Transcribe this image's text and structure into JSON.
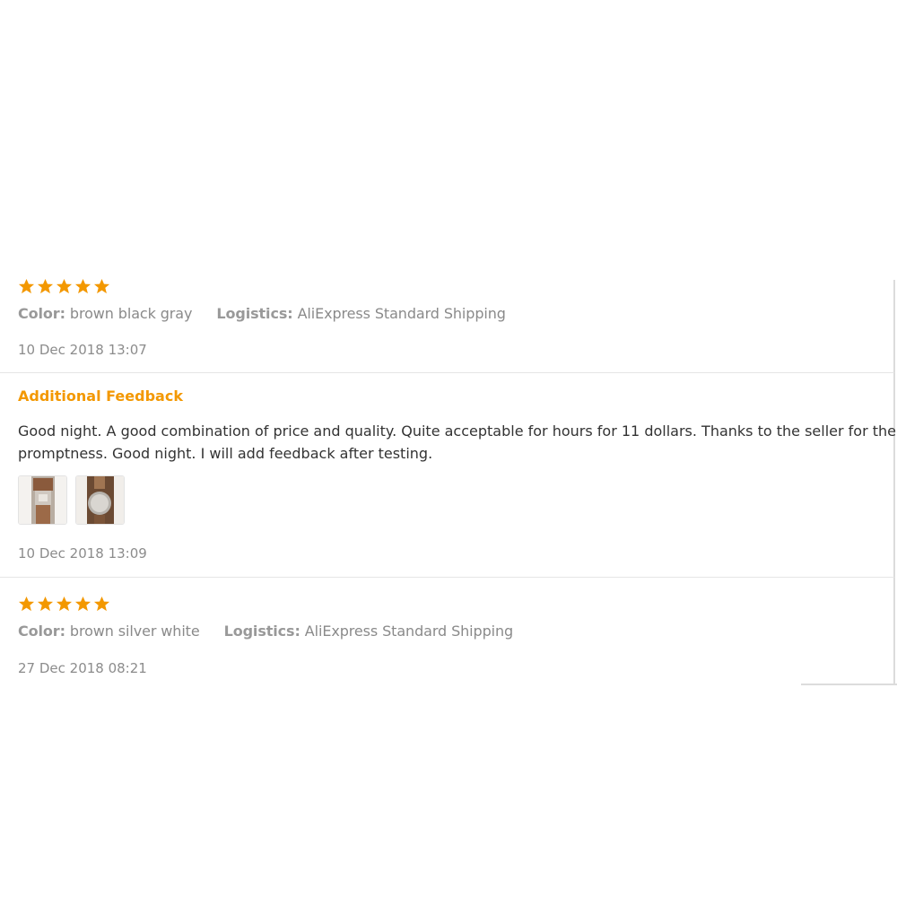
{
  "colors": {
    "star": "#f39800",
    "accent": "#f39800",
    "muted": "#8a8a8a",
    "divider": "#e5e5e5"
  },
  "reviews": [
    {
      "rating": 5,
      "color_label": "Color:",
      "color_value": "brown black gray",
      "logistics_label": "Logistics:",
      "logistics_value": "AliExpress Standard Shipping",
      "date": "10 Dec 2018 13:07",
      "additional": {
        "title": "Additional Feedback",
        "text_line1": "Good night. A good combination of price and quality. Quite acceptable for hours for 11 dollars. Thanks to the seller for the",
        "text_line2": "promptness. Good night. I will add feedback after testing.",
        "photos": [
          "watch-photo-1",
          "watch-photo-2"
        ],
        "date": "10 Dec 2018 13:09"
      }
    },
    {
      "rating": 5,
      "color_label": "Color:",
      "color_value": "brown silver white",
      "logistics_label": "Logistics:",
      "logistics_value": "AliExpress Standard Shipping",
      "date": "27 Dec 2018 08:21"
    }
  ]
}
